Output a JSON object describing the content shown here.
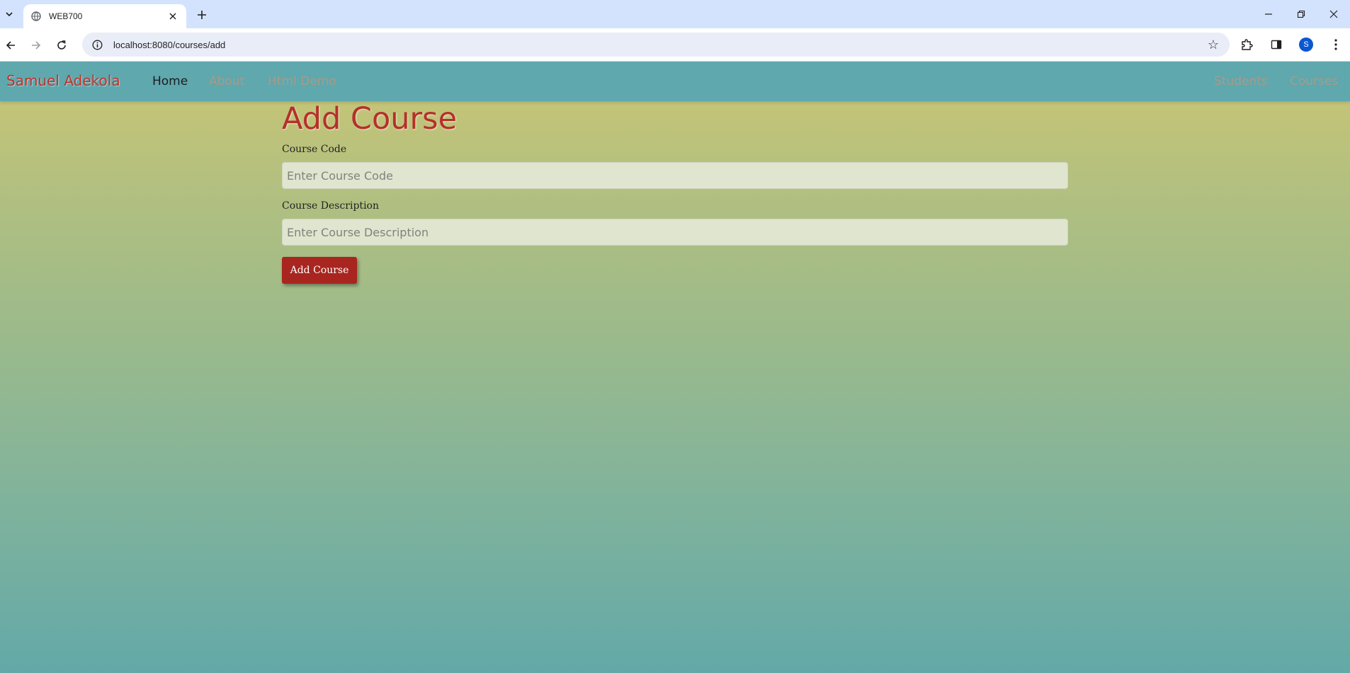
{
  "browser": {
    "tab_title": "WEB700",
    "url": "localhost:8080/courses/add",
    "profile_initial": "S"
  },
  "navbar": {
    "brand": "Samuel Adekola",
    "links_left": [
      "Home",
      "About",
      "Html Demo"
    ],
    "links_right": [
      "Students",
      "Courses"
    ],
    "active": "Home"
  },
  "page": {
    "title": "Add Course",
    "fields": [
      {
        "label": "Course Code",
        "placeholder": "Enter Course Code",
        "value": ""
      },
      {
        "label": "Course Description",
        "placeholder": "Enter Course Description",
        "value": ""
      }
    ],
    "submit_label": "Add Course"
  },
  "colors": {
    "navbar_bg": "#5ea8ae",
    "brand_color": "#c0312a",
    "title_color": "#b5302a",
    "button_bg": "#a8261f",
    "gradient_top": "#cbc673",
    "gradient_bottom": "#63a9a8"
  },
  "icons": {
    "tab_search": "chevron-down-icon",
    "favicon": "globe-icon",
    "tab_close": "close-icon",
    "new_tab": "plus-icon",
    "back": "arrow-left-icon",
    "forward": "arrow-right-icon",
    "reload": "reload-icon",
    "site_info": "info-icon",
    "bookmark": "star-icon",
    "extensions": "puzzle-icon",
    "side_panel": "side-panel-icon",
    "menu": "kebab-menu-icon"
  }
}
